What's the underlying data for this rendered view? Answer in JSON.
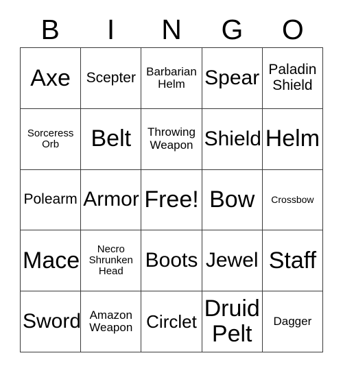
{
  "card": {
    "title": "BINGO",
    "background_color": "#ffffff",
    "text_color": "#000000",
    "border_color": "#3a3a3a"
  },
  "header": {
    "letters": [
      "B",
      "I",
      "N",
      "G",
      "O"
    ]
  },
  "grid": {
    "columns": 5,
    "rows": 5,
    "free_space_label": "Free!",
    "free_space_position": "center",
    "cells": [
      {
        "text": "Axe",
        "size": "fs-xxl"
      },
      {
        "text": "Scepter",
        "size": "fs-m"
      },
      {
        "text": "Barbarian\nHelm",
        "size": "fs-s"
      },
      {
        "text": "Spear",
        "size": "fs-xl"
      },
      {
        "text": "Paladin\nShield",
        "size": "fs-m"
      },
      {
        "text": "Sorceress\nOrb",
        "size": "fs-xs"
      },
      {
        "text": "Belt",
        "size": "fs-xxl"
      },
      {
        "text": "Throwing\nWeapon",
        "size": "fs-s"
      },
      {
        "text": "Shield",
        "size": "fs-xl"
      },
      {
        "text": "Helm",
        "size": "fs-xxl"
      },
      {
        "text": "Polearm",
        "size": "fs-m"
      },
      {
        "text": "Armor",
        "size": "fs-xl"
      },
      {
        "text": "Free!",
        "size": "fs-xxl"
      },
      {
        "text": "Bow",
        "size": "fs-xxl"
      },
      {
        "text": "Crossbow",
        "size": "fs-xxs"
      },
      {
        "text": "Mace",
        "size": "fs-xxl"
      },
      {
        "text": "Necro\nShrunken\nHead",
        "size": "fs-xs"
      },
      {
        "text": "Boots",
        "size": "fs-xl"
      },
      {
        "text": "Jewel",
        "size": "fs-xl"
      },
      {
        "text": "Staff",
        "size": "fs-xxl"
      },
      {
        "text": "Sword",
        "size": "fs-xl"
      },
      {
        "text": "Amazon\nWeapon",
        "size": "fs-s"
      },
      {
        "text": "Circlet",
        "size": "fs-l"
      },
      {
        "text": "Druid\nPelt",
        "size": "fs-xxl"
      },
      {
        "text": "Dagger",
        "size": "fs-s"
      }
    ]
  }
}
